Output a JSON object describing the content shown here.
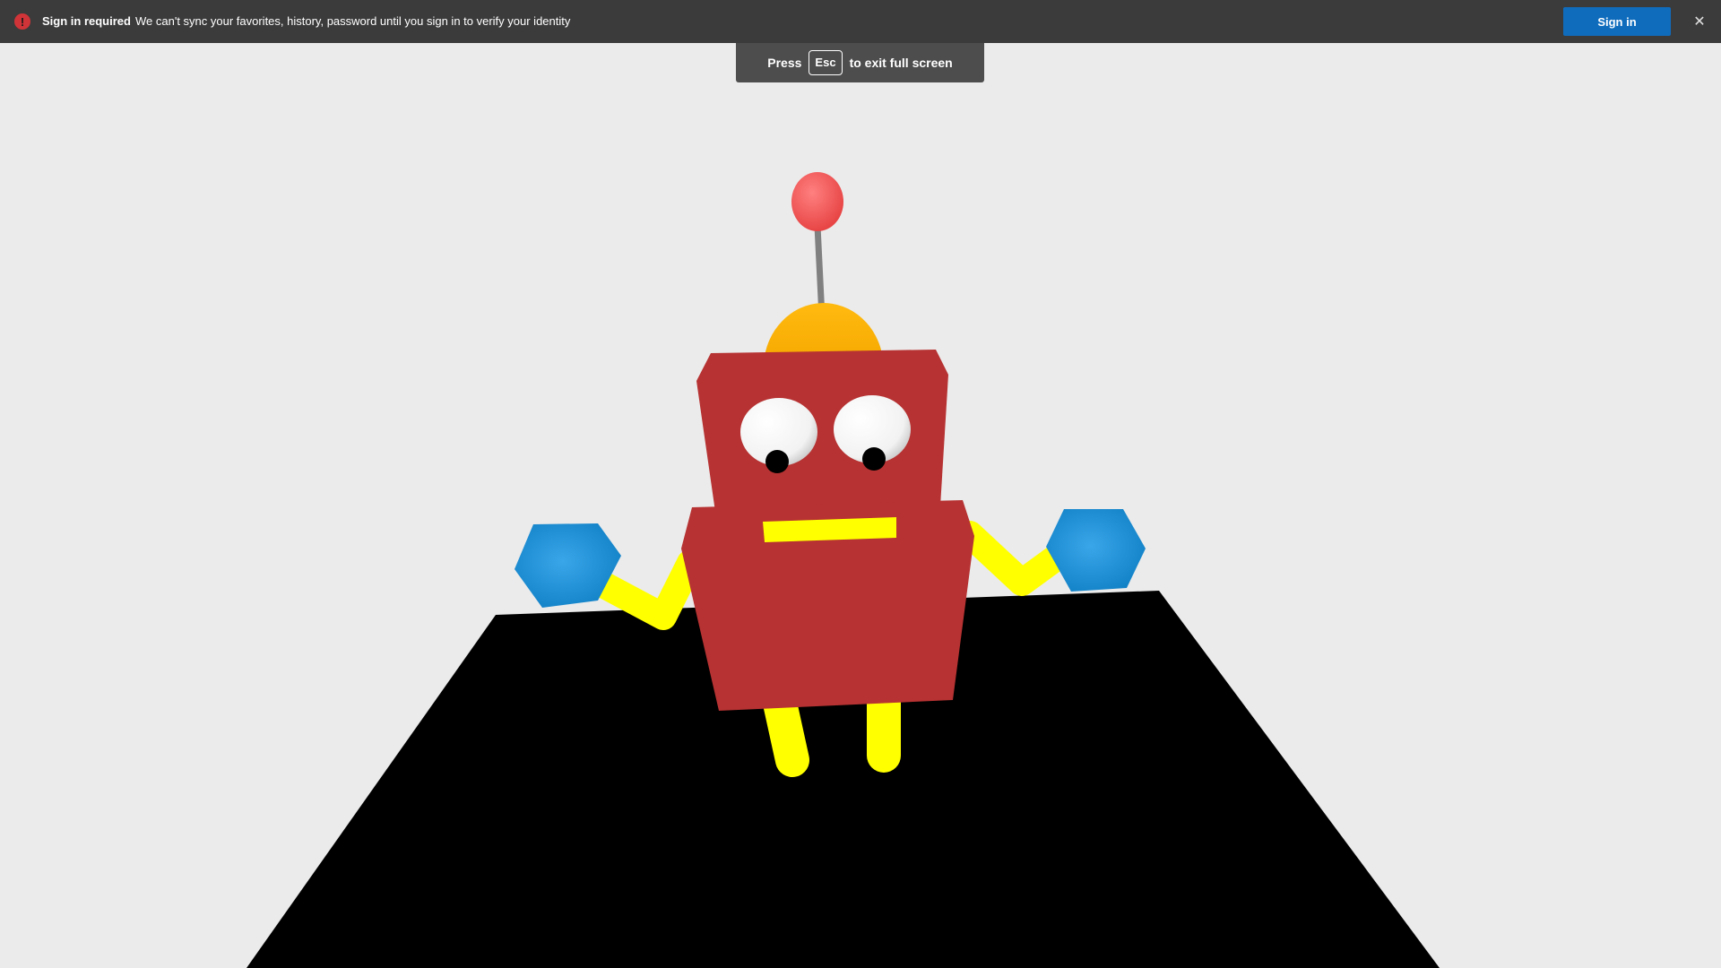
{
  "sync_bar": {
    "icon": "alert-icon",
    "icon_glyph": "!",
    "title": "Sign in required",
    "message": "We can't sync your favorites, history, password until you sign in to verify your identity",
    "signin_label": "Sign in",
    "close_glyph": "✕",
    "colors": {
      "bar": "#3b3b3b",
      "button": "#0f6cbd",
      "alert": "#d13438"
    }
  },
  "fullscreen_toast": {
    "press_label": "Press",
    "key_label": "Esc",
    "exit_label": "to exit full screen"
  },
  "scene": {
    "description_objects": [
      "robot",
      "floor"
    ],
    "colors": {
      "background": "#ebebeb",
      "floor": "#000000",
      "body": "#b73232",
      "hat": "#ffb000",
      "antenna_ball": "#ef5050",
      "limbs": "#ffff00",
      "hands": "#1d8fd6",
      "eyes": "#ffffff",
      "pupils": "#000000",
      "mouth": "#ffff00"
    }
  }
}
